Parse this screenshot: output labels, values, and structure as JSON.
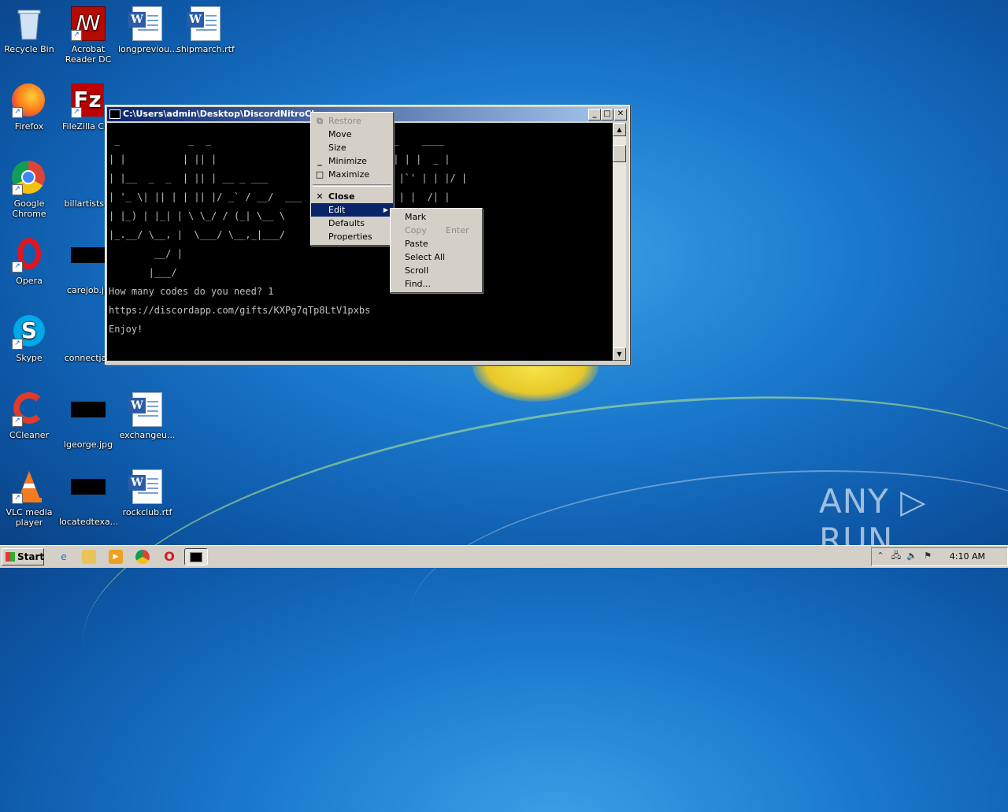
{
  "desktop": {
    "icons": [
      {
        "label": "Recycle Bin",
        "icon": "recycle-bin-icon"
      },
      {
        "label": "Acrobat\nReader DC",
        "icon": "acrobat-icon"
      },
      {
        "label": "longpreviou...",
        "icon": "word-document-icon"
      },
      {
        "label": "shipmarch.rtf",
        "icon": "word-document-icon"
      },
      {
        "label": "Firefox",
        "icon": "firefox-icon"
      },
      {
        "label": "FileZilla Clie",
        "icon": "filezilla-icon"
      },
      {
        "label": "Google\nChrome",
        "icon": "chrome-icon"
      },
      {
        "label": "billartists.p",
        "icon": "image-file-icon"
      },
      {
        "label": "Opera",
        "icon": "opera-icon"
      },
      {
        "label": "carejob.jp",
        "icon": "image-file-icon"
      },
      {
        "label": "Skype",
        "icon": "skype-icon"
      },
      {
        "label": "connectjan",
        "icon": "image-file-icon"
      },
      {
        "label": "CCleaner",
        "icon": "ccleaner-icon"
      },
      {
        "label": "lgeorge.jpg",
        "icon": "image-file-icon"
      },
      {
        "label": "exchangeu...",
        "icon": "word-document-icon"
      },
      {
        "label": "VLC media\nplayer",
        "icon": "vlc-icon"
      },
      {
        "label": "locatedtexa...",
        "icon": "image-file-icon"
      },
      {
        "label": "rockclub.rtf",
        "icon": "word-document-icon"
      }
    ],
    "watermark": "ANY ▷ RUN"
  },
  "console_window": {
    "title": "C:\\Users\\admin\\Desktop\\DiscordNitroChe",
    "buttons": {
      "minimize": "_",
      "maximize": "□",
      "close": "✕"
    },
    "ascii_art": [
      " _            _  _                         _  _  __    ____",
      "| |          | || |                       | || |/ | | |  _ |",
      "| |__  _  _  | || | __ _ ___        ___  __ __| || |`' | | |/ |",
      "| '_ \\| || | | || |/ _` / __/  ___  \\ \\/ / | || || | |  /| |",
      "| |_) | |_| | \\ \\_/ / (_| \\__ \\       \\  /\\_/ | |\\ \\|__/ |",
      "|_.__/ \\__, |  \\___/ \\__,_|___/          \\___(_)___(_)___/",
      "        __/ |",
      "       |___/"
    ],
    "lines": [
      "How many codes do you need? 1",
      "https://discordapp.com/gifts/KXPg7qTp8LtV1pxbs",
      "Enjoy!"
    ]
  },
  "system_menu": {
    "items": [
      {
        "label": "Restore",
        "disabled": true,
        "icon": "restore-icon"
      },
      {
        "label": "Move"
      },
      {
        "label": "Size"
      },
      {
        "label": "Minimize",
        "icon": "minimize-icon"
      },
      {
        "label": "Maximize",
        "icon": "maximize-icon"
      },
      {
        "label": "Close",
        "bold": true,
        "icon": "close-icon"
      },
      {
        "label": "Edit",
        "highlighted": true
      },
      {
        "label": "Defaults"
      },
      {
        "label": "Properties"
      }
    ]
  },
  "edit_submenu": {
    "items": [
      {
        "label": "Mark"
      },
      {
        "label": "Copy",
        "accelerator": "Enter",
        "disabled": true
      },
      {
        "label": "Paste"
      },
      {
        "label": "Select All"
      },
      {
        "label": "Scroll"
      },
      {
        "label": "Find..."
      }
    ]
  },
  "taskbar": {
    "start_label": "Start",
    "clock": "4:10 AM"
  },
  "colors": {
    "title_start": "#0a246a",
    "title_end": "#a6caf0",
    "highlight": "#0a246a"
  }
}
